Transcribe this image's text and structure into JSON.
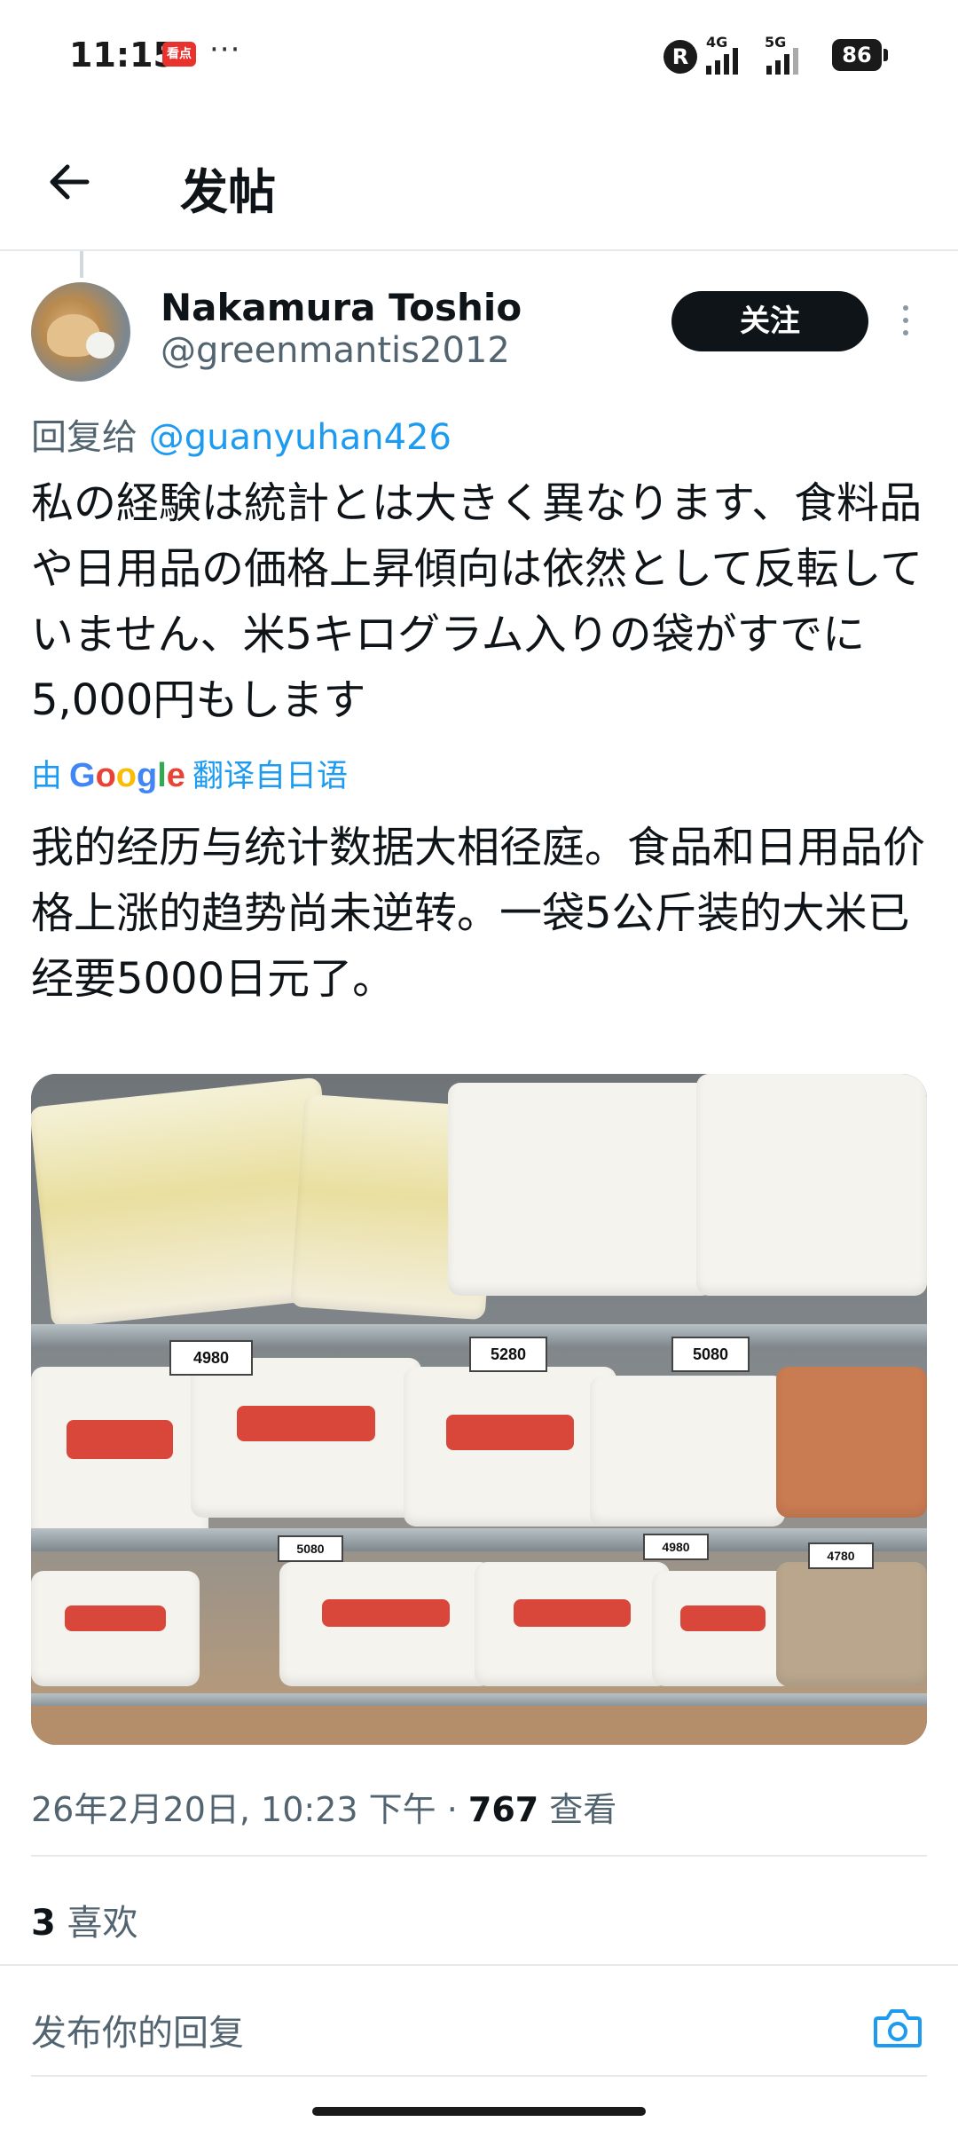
{
  "status_bar": {
    "time": "11:15",
    "app_badge": "看点",
    "more": "···",
    "roaming": "R",
    "network_1": "4G",
    "network_2": "5G",
    "battery": "86"
  },
  "header": {
    "title": "发帖"
  },
  "post": {
    "display_name": "Nakamura Toshio",
    "handle": "@greenmantis2012",
    "follow_label": "关注",
    "reply_to_prefix": "回复给",
    "reply_to_handle": "@guanyuhan426",
    "original_text": "私の経験は統計とは大きく異なります、食料品や日用品の価格上昇傾向は依然として反転していません、米5キログラム入りの袋がすでに5,000円もします",
    "translation_prefix": "由",
    "translation_brand": "Google",
    "translation_suffix": "翻译自日语",
    "translated_text": "我的经历与统计数据大相径庭。食品和日用品价格上涨的趋势尚未逆转。一袋5公斤装的大米已经要5000日元了。",
    "photo_price_tags": [
      "4980",
      "5280",
      "5080",
      "5080",
      "4980",
      "4780"
    ],
    "timestamp": "26年2月20日, 10:23 下午 · ",
    "views_count": "767",
    "views_label": " 查看",
    "likes_count": "3",
    "likes_label": " 喜欢"
  },
  "composer": {
    "placeholder": "发布你的回复"
  },
  "colors": {
    "link": "#1d9bf0",
    "text_primary": "#0f1419",
    "text_secondary": "#536471",
    "follow_button_bg": "#0f1419"
  }
}
